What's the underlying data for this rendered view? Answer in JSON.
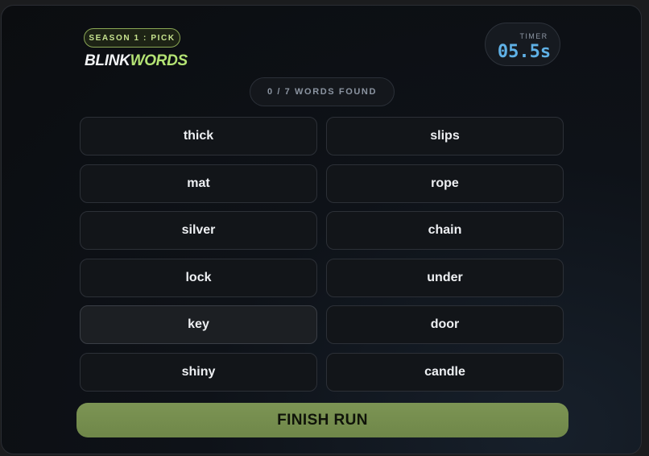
{
  "header": {
    "season_badge": "SEASON 1 : PICK",
    "logo_part1": "BLINK",
    "logo_part2": "WORDS"
  },
  "timer": {
    "label": "TIMER",
    "value": "05.5s"
  },
  "counter": {
    "text": "0 / 7 WORDS FOUND"
  },
  "words": {
    "left": [
      "thick",
      "mat",
      "silver",
      "lock",
      "key",
      "shiny"
    ],
    "right": [
      "slips",
      "rope",
      "chain",
      "under",
      "door",
      "candle"
    ]
  },
  "finish_button": {
    "label": "FINISH RUN"
  },
  "colors": {
    "accent_green": "#b4e374",
    "timer_blue": "#5fb1e6",
    "button_green": "#7c9454"
  }
}
